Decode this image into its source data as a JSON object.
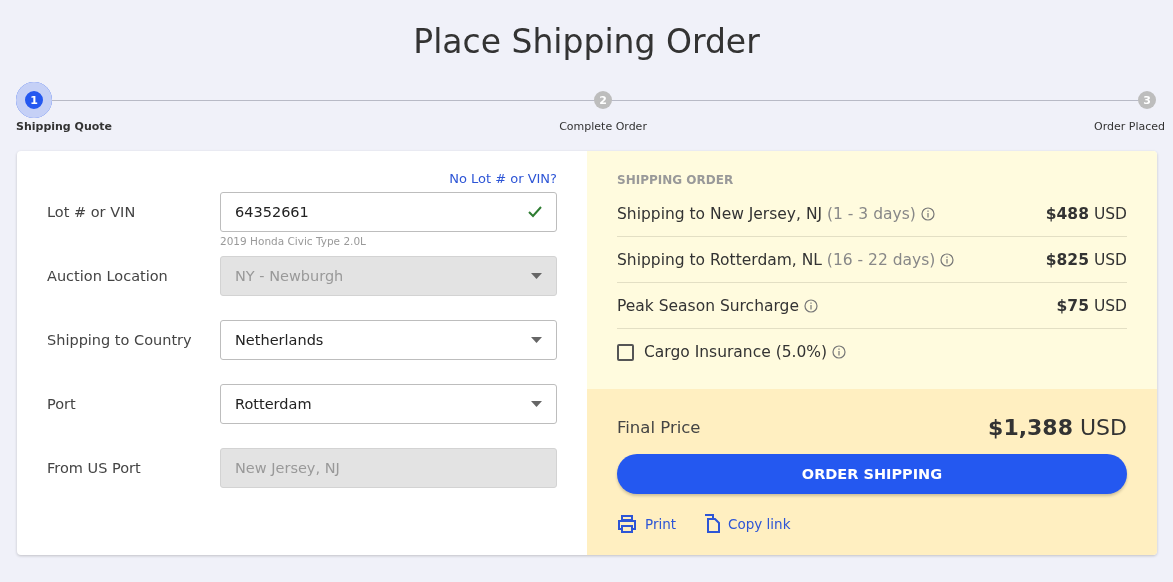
{
  "title": "Place Shipping Order",
  "steps": [
    {
      "number": "1",
      "label": "Shipping Quote",
      "selected": true
    },
    {
      "number": "2",
      "label": "Complete Order",
      "selected": false
    },
    {
      "number": "3",
      "label": "Order Placed",
      "selected": false
    }
  ],
  "form": {
    "link": "No Lot # or VIN?",
    "fields": [
      {
        "label": "Lot # or VIN",
        "kind": "text",
        "value": "64352661",
        "valid": true,
        "hint": "2019 Honda Civic Type 2.0L",
        "disabled": false
      },
      {
        "label": "Auction Location",
        "kind": "select",
        "value": "NY - Newburgh",
        "disabled": true
      },
      {
        "label": "Shipping to Country",
        "kind": "select",
        "value": "Netherlands",
        "disabled": false
      },
      {
        "label": "Port",
        "kind": "select",
        "value": "Rotterdam",
        "disabled": false
      },
      {
        "label": "From US Port",
        "kind": "text",
        "value": "New Jersey, NJ",
        "disabled": true
      }
    ]
  },
  "order": {
    "heading": "SHIPPING ORDER",
    "lines": [
      {
        "label": "Shipping to New Jersey, NJ",
        "detail": "(1 - 3 days)",
        "amount": "$488",
        "currency": "USD"
      },
      {
        "label": "Shipping to Rotterdam, NL",
        "detail": "(16 - 22 days)",
        "amount": "$825",
        "currency": "USD"
      },
      {
        "label": "Peak Season Surcharge",
        "amount": "$75",
        "currency": "USD"
      }
    ],
    "insurance": {
      "label": "Cargo Insurance (5.0%)",
      "checked": false
    },
    "final": {
      "label": "Final Price",
      "amount": "$1,388",
      "currency": "USD"
    },
    "button": "ORDER SHIPPING",
    "actions": [
      {
        "kind": "print",
        "label": "Print"
      },
      {
        "kind": "copy",
        "label": "Copy link"
      }
    ]
  }
}
